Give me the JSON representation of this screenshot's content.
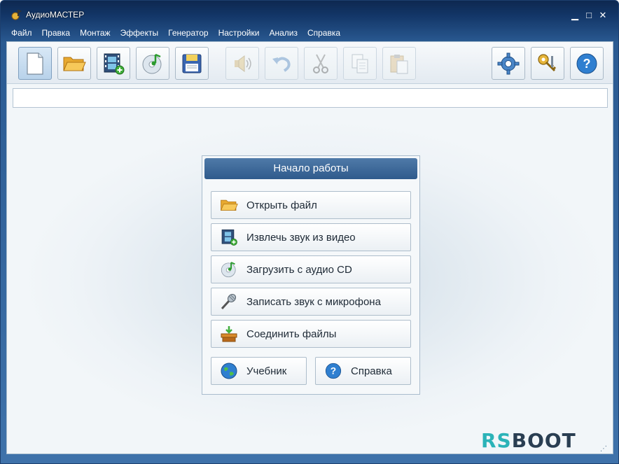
{
  "window": {
    "title": "АудиоМАСТЕР",
    "minimize": "▁",
    "maximize": "□",
    "close": "✕"
  },
  "menu": [
    "Файл",
    "Правка",
    "Монтаж",
    "Эффекты",
    "Генератор",
    "Настройки",
    "Анализ",
    "Справка"
  ],
  "toolbar": {
    "buttons": [
      {
        "icon": "new-file-icon",
        "state": "active"
      },
      {
        "icon": "open-folder-icon",
        "state": "enabled"
      },
      {
        "icon": "video-extract-icon",
        "state": "enabled"
      },
      {
        "icon": "audio-cd-icon",
        "state": "enabled"
      },
      {
        "icon": "save-floppy-icon",
        "state": "enabled"
      },
      {
        "icon": "volume-speaker-icon",
        "state": "disabled"
      },
      {
        "icon": "undo-icon",
        "state": "disabled"
      },
      {
        "icon": "cut-scissors-icon",
        "state": "disabled"
      },
      {
        "icon": "copy-icon",
        "state": "disabled"
      },
      {
        "icon": "paste-icon",
        "state": "disabled"
      },
      {
        "icon": "settings-gear-icon",
        "state": "enabled"
      },
      {
        "icon": "keys-icon",
        "state": "enabled"
      },
      {
        "icon": "help-icon",
        "state": "enabled"
      }
    ]
  },
  "start_panel": {
    "header": "Начало работы",
    "actions": [
      {
        "label": "Открыть файл",
        "icon": "open-folder-icon"
      },
      {
        "label": "Извлечь звук из видео",
        "icon": "video-extract-icon"
      },
      {
        "label": "Загрузить с аудио CD",
        "icon": "audio-cd-icon"
      },
      {
        "label": "Записать звук с микрофона",
        "icon": "microphone-icon"
      },
      {
        "label": "Соединить файлы",
        "icon": "merge-files-icon"
      }
    ],
    "tutorial_label": "Учебник",
    "help_label": "Справка"
  },
  "watermark": {
    "part1": "RS",
    "part2": "BOOT"
  },
  "colors": {
    "accent": "#2f5a8c",
    "title_bar": "#123566",
    "watermark_rs": "#2bb3b8",
    "watermark_boot": "#2a3e52"
  }
}
